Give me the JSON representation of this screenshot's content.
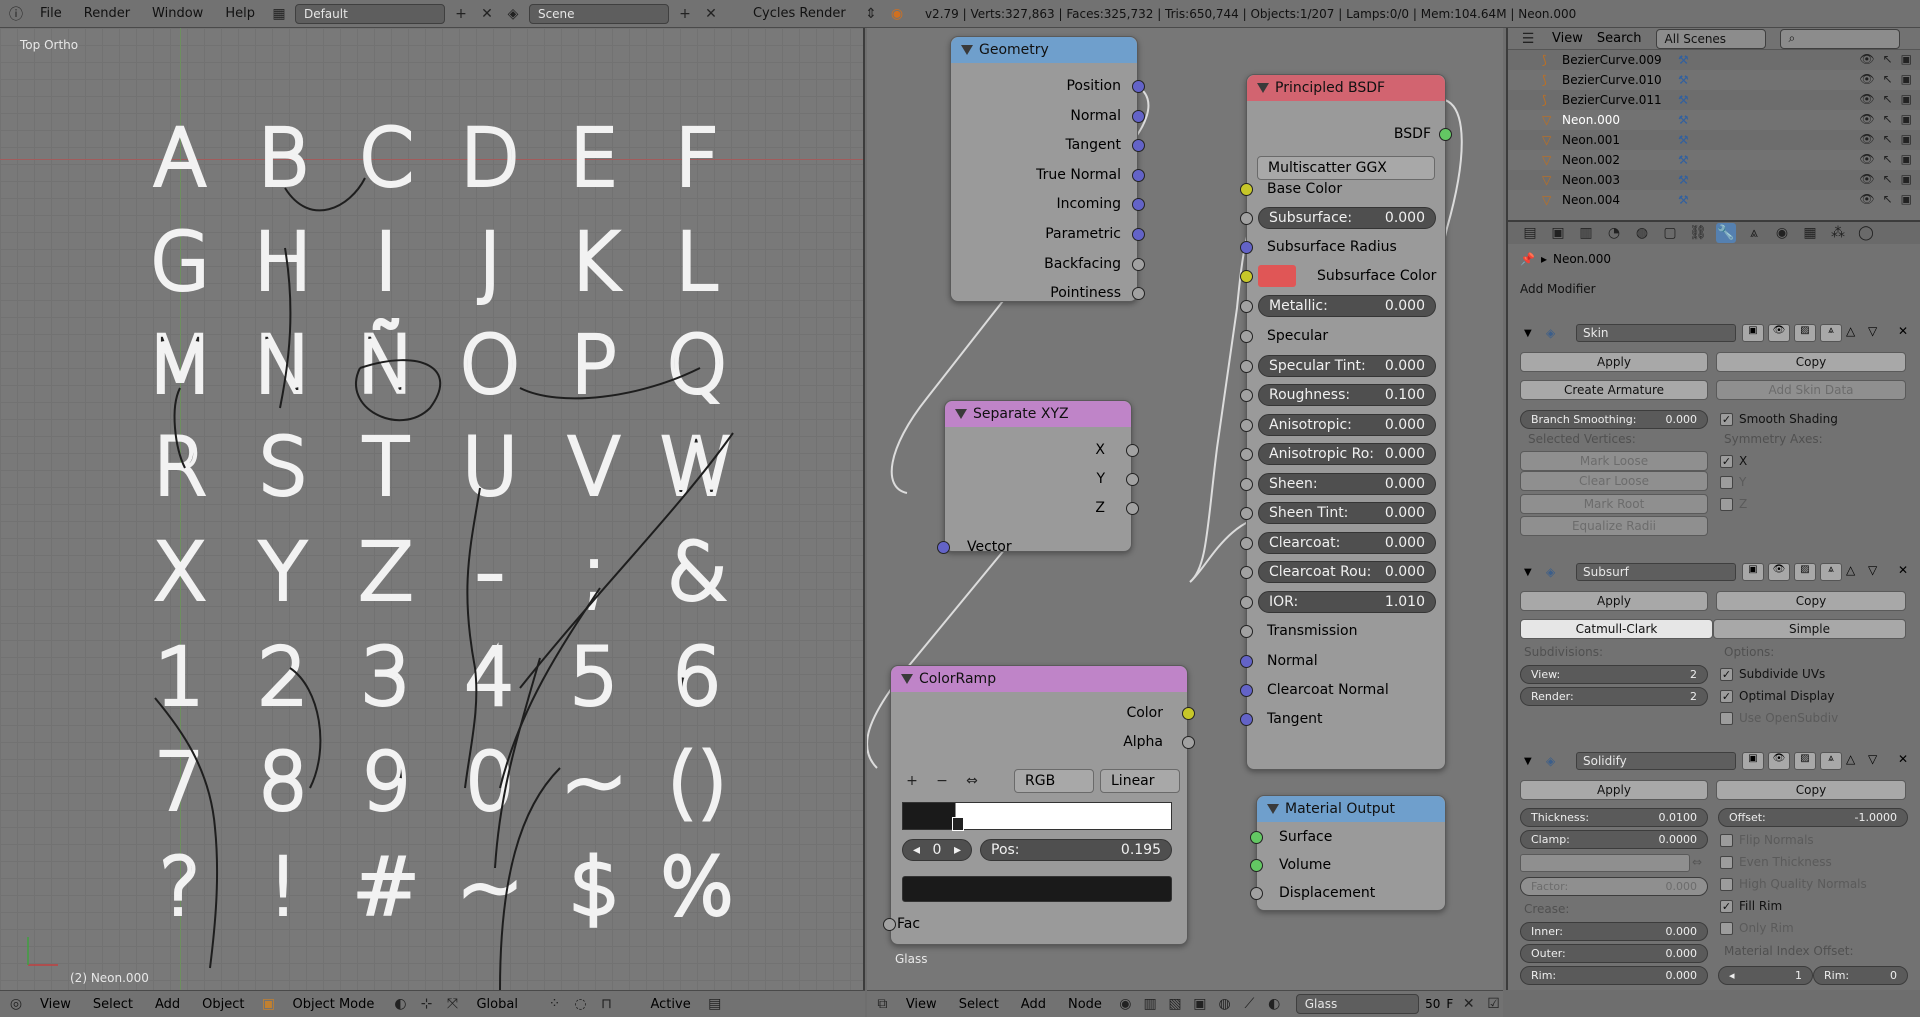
{
  "topbar": {
    "menus": [
      "File",
      "Render",
      "Window",
      "Help"
    ],
    "layout": "Default",
    "scene": "Scene",
    "engine": "Cycles Render",
    "stats": "v2.79 | Verts:327,863 | Faces:325,732 | Tris:650,744 | Objects:1/207 | Lamps:0/0 | Mem:104.64M | Neon.000"
  },
  "viewport": {
    "view_label": "Top Ortho",
    "object_label": "(2) Neon.000",
    "glyphs": [
      "A",
      "B",
      "C",
      "D",
      "E",
      "F",
      "G",
      "H",
      "I",
      "J",
      "K",
      "L",
      "M",
      "N",
      "Ñ",
      "O",
      "P",
      "Q",
      "R",
      "S",
      "T",
      "U",
      "V",
      "W",
      "X",
      "Y",
      "Z",
      "-",
      ";",
      "&",
      "1",
      "2",
      "3",
      "4",
      "5",
      "6",
      "7",
      "8",
      "9",
      "0",
      "~",
      "()",
      "?",
      "!",
      "#",
      "~",
      "$",
      "%"
    ],
    "footer": {
      "menus": [
        "View",
        "Select",
        "Add",
        "Object"
      ],
      "mode": "Object Mode",
      "orientation": "Global",
      "pivot": "Active"
    }
  },
  "nodes": {
    "geometry": {
      "title": "Geometry",
      "outputs": [
        "Position",
        "Normal",
        "Tangent",
        "True Normal",
        "Incoming",
        "Parametric",
        "Backfacing",
        "Pointiness"
      ]
    },
    "separate_xyz": {
      "title": "Separate XYZ",
      "outputs": [
        "X",
        "Y",
        "Z"
      ],
      "input": "Vector"
    },
    "colorramp": {
      "title": "ColorRamp",
      "outputs": [
        "Color",
        "Alpha"
      ],
      "mode": "RGB",
      "interp": "Linear",
      "index": "0",
      "pos_label": "Pos:",
      "pos_value": "0.195",
      "input": "Fac"
    },
    "principled": {
      "title": "Principled BSDF",
      "output": "BSDF",
      "distribution": "Multiscatter GGX",
      "base_color": "Base Color",
      "subsurface_radius": "Subsurface Radius",
      "subsurface_color": "Subsurface Color",
      "specular": "Specular",
      "transmission": "Transmission",
      "normal": "Normal",
      "clearcoat_normal": "Clearcoat Normal",
      "tangent": "Tangent",
      "fields": [
        {
          "label": "Subsurface:",
          "value": "0.000"
        },
        {
          "label": "Metallic:",
          "value": "0.000"
        },
        {
          "label": "Specular Tint:",
          "value": "0.000"
        },
        {
          "label": "Roughness:",
          "value": "0.100"
        },
        {
          "label": "Anisotropic:",
          "value": "0.000"
        },
        {
          "label": "Anisotropic Ro:",
          "value": "0.000"
        },
        {
          "label": "Sheen:",
          "value": "0.000"
        },
        {
          "label": "Sheen Tint:",
          "value": "0.000"
        },
        {
          "label": "Clearcoat:",
          "value": "0.000"
        },
        {
          "label": "Clearcoat Rou:",
          "value": "0.000"
        },
        {
          "label": "IOR:",
          "value": "1.010"
        }
      ]
    },
    "material_output": {
      "title": "Material Output",
      "inputs": [
        "Surface",
        "Volume",
        "Displacement"
      ]
    },
    "material_name_label": "Glass",
    "footer": {
      "menus": [
        "View",
        "Select",
        "Add",
        "Node"
      ],
      "material": "Glass",
      "users": "50",
      "fake": "F"
    }
  },
  "outliner": {
    "menus": [
      "View",
      "Search"
    ],
    "filter": "All Scenes",
    "items": [
      "BezierCurve.009",
      "BezierCurve.010",
      "BezierCurve.011",
      "Neon.000",
      "Neon.001",
      "Neon.002",
      "Neon.003",
      "Neon.004"
    ]
  },
  "properties": {
    "object": "Neon.000",
    "add_modifier": "Add Modifier",
    "skin": {
      "name": "Skin",
      "apply": "Apply",
      "copy": "Copy",
      "create_armature": "Create Armature",
      "add_skin_data": "Add Skin Data",
      "branch_smoothing_label": "Branch Smoothing:",
      "branch_smoothing_value": "0.000",
      "smooth_shading": "Smooth Shading",
      "selected_vertices": "Selected Vertices:",
      "symmetry_axes": "Symmetry Axes:",
      "mark_loose": "Mark Loose",
      "clear_loose": "Clear Loose",
      "mark_root": "Mark Root",
      "equalize_radii": "Equalize Radii",
      "x": "X",
      "y": "Y",
      "z": "Z"
    },
    "subsurf": {
      "name": "Subsurf",
      "apply": "Apply",
      "copy": "Copy",
      "catmull": "Catmull-Clark",
      "simple": "Simple",
      "subdivisions": "Subdivisions:",
      "options": "Options:",
      "view_label": "View:",
      "view_value": "2",
      "render_label": "Render:",
      "render_value": "2",
      "subdivide_uvs": "Subdivide UVs",
      "optimal_display": "Optimal Display",
      "use_opensubdiv": "Use OpenSubdiv"
    },
    "solidify": {
      "name": "Solidify",
      "apply": "Apply",
      "copy": "Copy",
      "thickness_label": "Thickness:",
      "thickness_value": "0.0100",
      "offset_label": "Offset:",
      "offset_value": "-1.0000",
      "clamp_label": "Clamp:",
      "clamp_value": "0.0000",
      "flip_normals": "Flip Normals",
      "even_thickness": "Even Thickness",
      "high_quality_normals": "High Quality Normals",
      "fill_rim": "Fill Rim",
      "only_rim": "Only Rim",
      "factor_label": "Factor:",
      "factor_value": "0.000",
      "crease": "Crease:",
      "inner_label": "Inner:",
      "inner_value": "0.000",
      "outer_label": "Outer:",
      "outer_value": "0.000",
      "rim_label": "Rim:",
      "rim_value": "0.000",
      "mat_index_offset": "Material Index Offset:",
      "mat_index_value": "1",
      "rim2_label": "Rim:",
      "rim2_value": "0"
    }
  },
  "colors": {
    "geometry_header": "#6f9fcc",
    "principled_header": "#d26470",
    "xyz_header": "#bf84c8",
    "colorramp_header": "#bf84c8",
    "output_header": "#6f9fcc",
    "socket_vector": "#6363c7",
    "socket_float": "#a1a1a1",
    "socket_color": "#c7c729",
    "socket_shader": "#63c763",
    "subsurface_color_swatch": "#e05656"
  }
}
